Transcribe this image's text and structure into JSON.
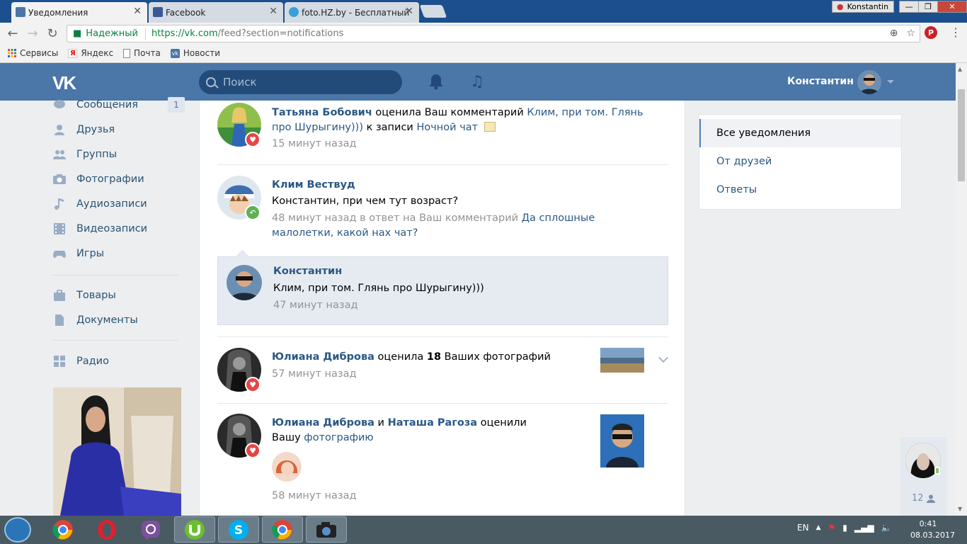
{
  "browser": {
    "tabs": [
      {
        "title": "Уведомления",
        "active": true,
        "icon": "vk-icon"
      },
      {
        "title": "Facebook",
        "active": false,
        "icon": "facebook-icon"
      },
      {
        "title": "foto.HZ.by - Бесплатный",
        "active": false,
        "icon": "fotohz-icon"
      }
    ],
    "profile_user": "Konstantin",
    "window_controls": {
      "minimize": "—",
      "restore": "❐",
      "close": "✕"
    },
    "security_label": "Надежный",
    "url_host": "https://vk.com",
    "url_path": "/feed?section=notifications",
    "bookmarks": [
      {
        "label": "Сервисы",
        "icon": "apps-icon"
      },
      {
        "label": "Яндекс",
        "icon": "yandex-icon"
      },
      {
        "label": "Почта",
        "icon": "page-icon"
      },
      {
        "label": "Новости",
        "icon": "vk-icon"
      }
    ]
  },
  "header": {
    "logo": "VK",
    "search_placeholder": "Поиск",
    "user_name": "Константин"
  },
  "sidebar": {
    "items": [
      {
        "label": "Сообщения",
        "icon": "messages-icon",
        "badge": "1"
      },
      {
        "label": "Друзья",
        "icon": "friends-icon"
      },
      {
        "label": "Группы",
        "icon": "groups-icon"
      },
      {
        "label": "Фотографии",
        "icon": "camera-icon"
      },
      {
        "label": "Аудиозаписи",
        "icon": "music-icon"
      },
      {
        "label": "Видеозаписи",
        "icon": "video-icon"
      },
      {
        "label": "Игры",
        "icon": "gamepad-icon"
      },
      {
        "label": "Товары",
        "icon": "bag-icon"
      },
      {
        "label": "Документы",
        "icon": "document-icon"
      },
      {
        "label": "Радио",
        "icon": "apps-grid-icon"
      }
    ]
  },
  "feed": {
    "n1": {
      "author": "Татьяна Бобович",
      "action": " оценила Ваш комментарий ",
      "comment": "Клим, при том. Глянь про Шурыгину)))",
      "to_post": " к записи ",
      "post": "Ночной чат",
      "time": "15 минут назад"
    },
    "n2": {
      "author": "Клим Вествуд",
      "text": "Константин, при чем тут возраст?",
      "time_prefix": "48 минут назад в ответ на Ваш комментарий ",
      "reply_to": "Да сплошные малолетки, какой нах чат?"
    },
    "n2_reply": {
      "author": "Константин",
      "text": "Клим, при том. Глянь про Шурыгину)))",
      "time": "47 минут назад"
    },
    "n3": {
      "author": "Юлиана Диброва",
      "action": " оценила ",
      "count": "18",
      "object": " Ваших фотографий",
      "time": "57 минут назад"
    },
    "n4": {
      "author1": "Юлиана Диброва",
      "and": " и ",
      "author2": "Наташа Рагоза",
      "action": " оценили Вашу ",
      "object": "фотографию",
      "time": "58 минут назад"
    }
  },
  "filters": {
    "items": [
      {
        "label": "Все уведомления",
        "active": true
      },
      {
        "label": "От друзей",
        "active": false
      },
      {
        "label": "Ответы",
        "active": false
      }
    ]
  },
  "chat_widget": {
    "count": "12"
  },
  "taskbar": {
    "lang": "EN",
    "time": "0:41",
    "date": "08.03.2017"
  },
  "colors": {
    "vk_blue": "#4a76a8",
    "link": "#2a5885",
    "like_red": "#e64646",
    "reply_green": "#5fb053"
  }
}
